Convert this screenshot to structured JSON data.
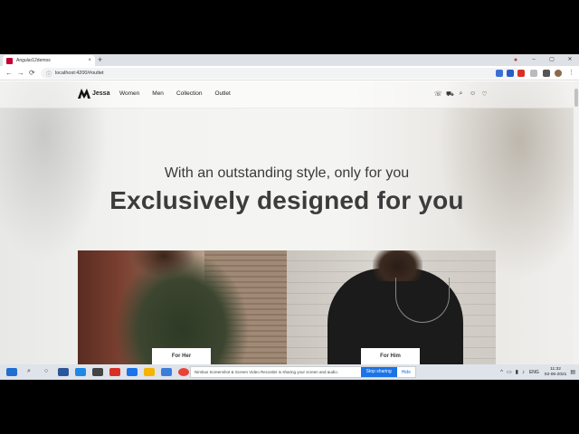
{
  "browser": {
    "tab_title": "Angular12demos",
    "tab_close": "×",
    "new_tab": "+",
    "url": "localhost:4200/#outlet",
    "back": "←",
    "forward": "→",
    "reload": "⟳",
    "minimize": "–",
    "maximize": "▢",
    "close": "✕"
  },
  "site": {
    "brand": "Jessa",
    "menu": [
      "Women",
      "Men",
      "Collection",
      "Outlet"
    ],
    "icons": [
      "phone-icon",
      "cart-icon",
      "search-icon",
      "user-icon",
      "heart-icon"
    ],
    "icon_glyphs": [
      "☏",
      "⛟",
      "⌕",
      "☺",
      "♡"
    ]
  },
  "hero": {
    "subtitle": "With an outstanding style, only for you",
    "headline": "Exclusively designed for you"
  },
  "cards": {
    "her_label": "For Her",
    "him_label": "For Him"
  },
  "sharing_bar": {
    "message": "Nimbus Screenshot & Screen Video Recorder is sharing your screen and audio.",
    "stop_label": "Stop sharing",
    "hide_label": "Hide"
  },
  "taskbar": {
    "language": "ENG",
    "time": "11:32",
    "date": "02-06-2021"
  },
  "colors": {
    "accent": "#1a73e8",
    "headline": "#3c3c3c"
  }
}
